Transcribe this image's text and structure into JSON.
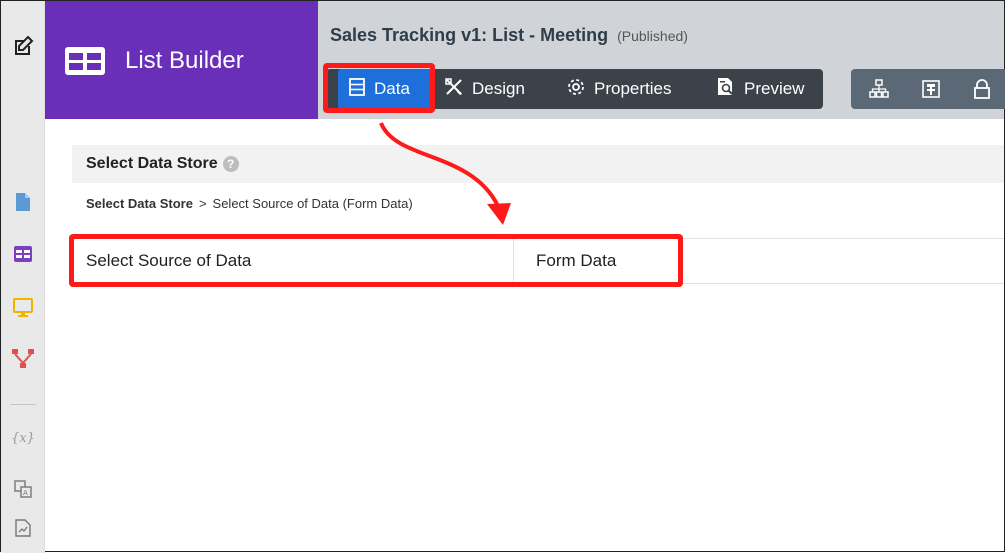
{
  "header": {
    "app_name": "List Builder",
    "title": "Sales Tracking v1: List - Meeting",
    "status": "(Published)"
  },
  "tabs": [
    {
      "label": "Data",
      "icon": "data-icon",
      "active": true
    },
    {
      "label": "Design",
      "icon": "design-icon"
    },
    {
      "label": "Properties",
      "icon": "gear-icon"
    },
    {
      "label": "Preview",
      "icon": "preview-icon"
    }
  ],
  "right_toolbar_icons": [
    "sitemap-icon",
    "form-icon",
    "lock-icon"
  ],
  "left_rail_icons": [
    "edit-icon",
    "document-icon",
    "list-icon",
    "monitor-icon",
    "workflow-icon",
    "variable-icon",
    "translate-icon",
    "report-icon"
  ],
  "variable_symbol": "{x}",
  "panel": {
    "title": "Select Data Store",
    "help": "?"
  },
  "breadcrumb": {
    "root": "Select Data Store",
    "separator": ">",
    "current": "Select Source of Data (Form Data)"
  },
  "source_row": {
    "label": "Select Source of Data",
    "value": "Form Data"
  },
  "colors": {
    "brand": "#6a2fb8",
    "active_tab": "#1e6fd9",
    "highlight": "#ff1a1a"
  }
}
